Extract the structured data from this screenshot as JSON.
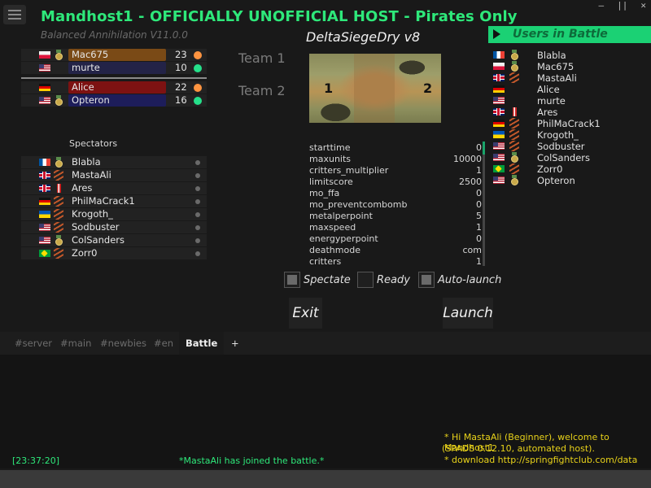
{
  "window": {
    "controls": [
      "—",
      "||",
      "✕"
    ]
  },
  "title": "Mandhost1 - OFFICIALLY UNOFFICIAL HOST - Pirates Only",
  "game": "Balanced Annihilation V11.0.0",
  "map": "DeltaSiegeDry v8",
  "teams": {
    "team1_label": "Team 1",
    "team2_label": "Team 2"
  },
  "team1": [
    {
      "name": "Mac675",
      "value": "23",
      "flag": "pl",
      "rank": "medal",
      "status": "orange",
      "color": "c-orange"
    },
    {
      "name": "murte",
      "value": "10",
      "flag": "us",
      "rank": "star",
      "status": "green",
      "color": "c-dark"
    }
  ],
  "team2": [
    {
      "name": "Alice",
      "value": "22",
      "flag": "de",
      "rank": "star",
      "status": "orange",
      "color": "c-red"
    },
    {
      "name": "Opteron",
      "value": "16",
      "flag": "us",
      "rank": "medal",
      "status": "green",
      "color": "c-navy"
    }
  ],
  "spectators_label": "Spectators",
  "spectators": [
    {
      "name": "Blabla",
      "flag": "fr",
      "rank": "medal"
    },
    {
      "name": "MastaAli",
      "flag": "gb",
      "rank": "stripes"
    },
    {
      "name": "Ares",
      "flag": "gb",
      "rank": "redbar"
    },
    {
      "name": "PhilMaCrack1",
      "flag": "de",
      "rank": "stripes"
    },
    {
      "name": "Krogoth_",
      "flag": "ua",
      "rank": "stripes"
    },
    {
      "name": "Sodbuster",
      "flag": "us",
      "rank": "stripes"
    },
    {
      "name": "ColSanders",
      "flag": "us",
      "rank": "medal"
    },
    {
      "name": "Zorr0",
      "flag": "br",
      "rank": "stripes"
    }
  ],
  "minimap": {
    "start1": "1",
    "start2": "2"
  },
  "options": [
    {
      "key": "starttime",
      "value": "0"
    },
    {
      "key": "maxunits",
      "value": "10000"
    },
    {
      "key": "critters_multiplier",
      "value": "1"
    },
    {
      "key": "limitscore",
      "value": "2500"
    },
    {
      "key": "mo_ffa",
      "value": "0"
    },
    {
      "key": "mo_preventcombomb",
      "value": "0"
    },
    {
      "key": "metalperpoint",
      "value": "5"
    },
    {
      "key": "maxspeed",
      "value": "1"
    },
    {
      "key": "energyperpoint",
      "value": "0"
    },
    {
      "key": "deathmode",
      "value": "com"
    },
    {
      "key": "critters",
      "value": "1"
    }
  ],
  "checkboxes": {
    "spectate": "Spectate",
    "ready": "Ready",
    "autolaunch": "Auto-launch"
  },
  "buttons": {
    "exit": "Exit",
    "launch": "Launch"
  },
  "users_header": "Users in Battle",
  "users": [
    {
      "name": "Blabla",
      "flag": "fr",
      "rank": "medal"
    },
    {
      "name": "Mac675",
      "flag": "pl",
      "rank": "medal"
    },
    {
      "name": "MastaAli",
      "flag": "gb",
      "rank": "stripes"
    },
    {
      "name": "Alice",
      "flag": "de",
      "rank": "star"
    },
    {
      "name": "murte",
      "flag": "us",
      "rank": "star"
    },
    {
      "name": "Ares",
      "flag": "gb",
      "rank": "redbar"
    },
    {
      "name": "PhilMaCrack1",
      "flag": "de",
      "rank": "stripes"
    },
    {
      "name": "Krogoth_",
      "flag": "ua",
      "rank": "stripes"
    },
    {
      "name": "Sodbuster",
      "flag": "us",
      "rank": "stripes"
    },
    {
      "name": "ColSanders",
      "flag": "us",
      "rank": "medal"
    },
    {
      "name": "Zorr0",
      "flag": "br",
      "rank": "stripes"
    },
    {
      "name": "Opteron",
      "flag": "us",
      "rank": "medal"
    }
  ],
  "chat": {
    "tabs": [
      "#server",
      "#main",
      "#newbies",
      "#en",
      "Battle",
      "+"
    ],
    "active_tab": "Battle",
    "timestamp": "[23:37:20]",
    "join_msg": "*MastaAli has joined the battle.*",
    "host_msg1": "* Hi MastaAli (Beginner), welcome to Mandhost1",
    "host_msg2": "(SPADS 0.12.10, automated host).",
    "host_msg3": "* download http://springfightclub.com/data"
  },
  "colors": {
    "accent_green": "#2ee87a",
    "header_green": "#1bd174",
    "chat_yellow": "#e8d21a",
    "chat_green": "#2ee87a"
  }
}
